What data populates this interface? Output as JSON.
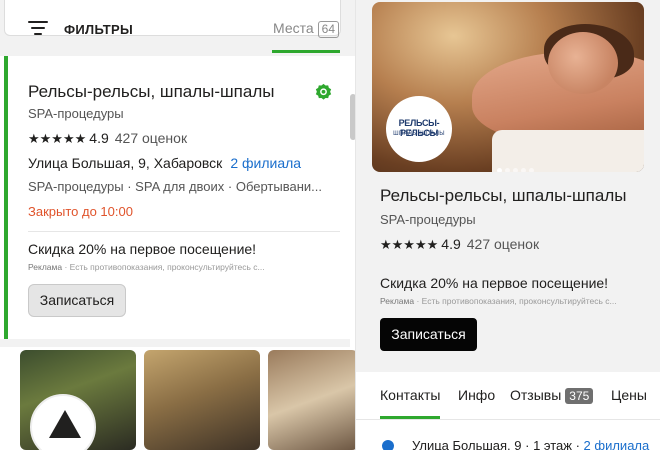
{
  "list": {
    "filters_label": "ФИЛЬТРЫ",
    "places_tab_label": "Места",
    "places_count": "64",
    "card": {
      "title": "Рельсы-рельсы, шпалы-шпалы",
      "category": "SPA-процедуры",
      "stars": "★★★★★",
      "rating": "4.9",
      "reviews": "427 оценок",
      "address": "Улица Большая, 9, Хабаровск",
      "branches": "2 филиала",
      "services": "SPA-процедуры · SPA для двоих · Обертывани...",
      "hours_status": "Закрыто до 10:00",
      "promo": "Скидка 20% на первое посещение!",
      "ad_label": "Реклама",
      "ad_disclaimer": "Есть противопоказания, проконсультируйтесь с...",
      "book_button": "Записаться"
    }
  },
  "detail": {
    "logo_line1": "РЕЛЬСЫ-РЕЛЬСЫ",
    "logo_line2": "ШПАЛЫ-ШПАЛЫ",
    "title": "Рельсы-рельсы, шпалы-шпалы",
    "category": "SPA-процедуры",
    "stars": "★★★★★",
    "rating": "4.9",
    "reviews": "427 оценок",
    "promo": "Скидка 20% на первое посещение!",
    "ad_label": "Реклама",
    "ad_disclaimer": "Есть противопоказания, проконсультируйтесь с...",
    "book_button": "Записаться",
    "tabs": [
      {
        "label": "Контакты"
      },
      {
        "label": "Инфо"
      },
      {
        "label": "Отзывы",
        "count": "375"
      },
      {
        "label": "Цены"
      }
    ],
    "address_line": "Улица Большая, 9 · 1 этаж · ",
    "address_branches": "2 филиала",
    "gallery_slide": 1,
    "gallery_total": 5
  },
  "colors": {
    "accent_green": "#2ea82e",
    "link_blue": "#1a6ecc",
    "closed_orange": "#e0542c"
  },
  "icons": [
    "filter-icon",
    "verified-icon",
    "location-dot-icon"
  ]
}
